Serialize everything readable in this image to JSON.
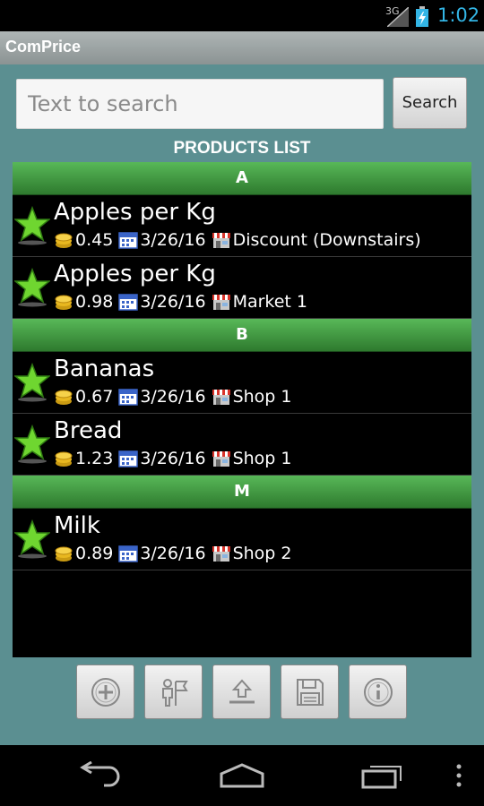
{
  "status": {
    "network": "3G",
    "time": "1:02"
  },
  "app": {
    "title": "ComPrice"
  },
  "search": {
    "placeholder": "Text to search",
    "button_label": "Search"
  },
  "list": {
    "title": "PRODUCTS LIST",
    "sections": [
      {
        "letter": "A",
        "items": [
          {
            "name": "Apples per Kg",
            "price": "0.45",
            "date": "3/26/16",
            "store": "Discount (Downstairs)"
          },
          {
            "name": "Apples per Kg",
            "price": "0.98",
            "date": "3/26/16",
            "store": "Market 1"
          }
        ]
      },
      {
        "letter": "B",
        "items": [
          {
            "name": "Bananas",
            "price": "0.67",
            "date": "3/26/16",
            "store": "Shop 1"
          },
          {
            "name": "Bread",
            "price": "1.23",
            "date": "3/26/16",
            "store": "Shop 1"
          }
        ]
      },
      {
        "letter": "M",
        "items": [
          {
            "name": "Milk",
            "price": "0.89",
            "date": "3/26/16",
            "store": "Shop 2"
          }
        ]
      }
    ]
  },
  "toolbar": {
    "buttons": [
      "add-icon",
      "person-flag-icon",
      "upload-icon",
      "save-icon",
      "info-icon"
    ]
  },
  "colors": {
    "accent_time": "#33b5e5",
    "background": "#5b8f91",
    "section_green": "#3c9a3c",
    "star_green": "#5fcf2a"
  }
}
